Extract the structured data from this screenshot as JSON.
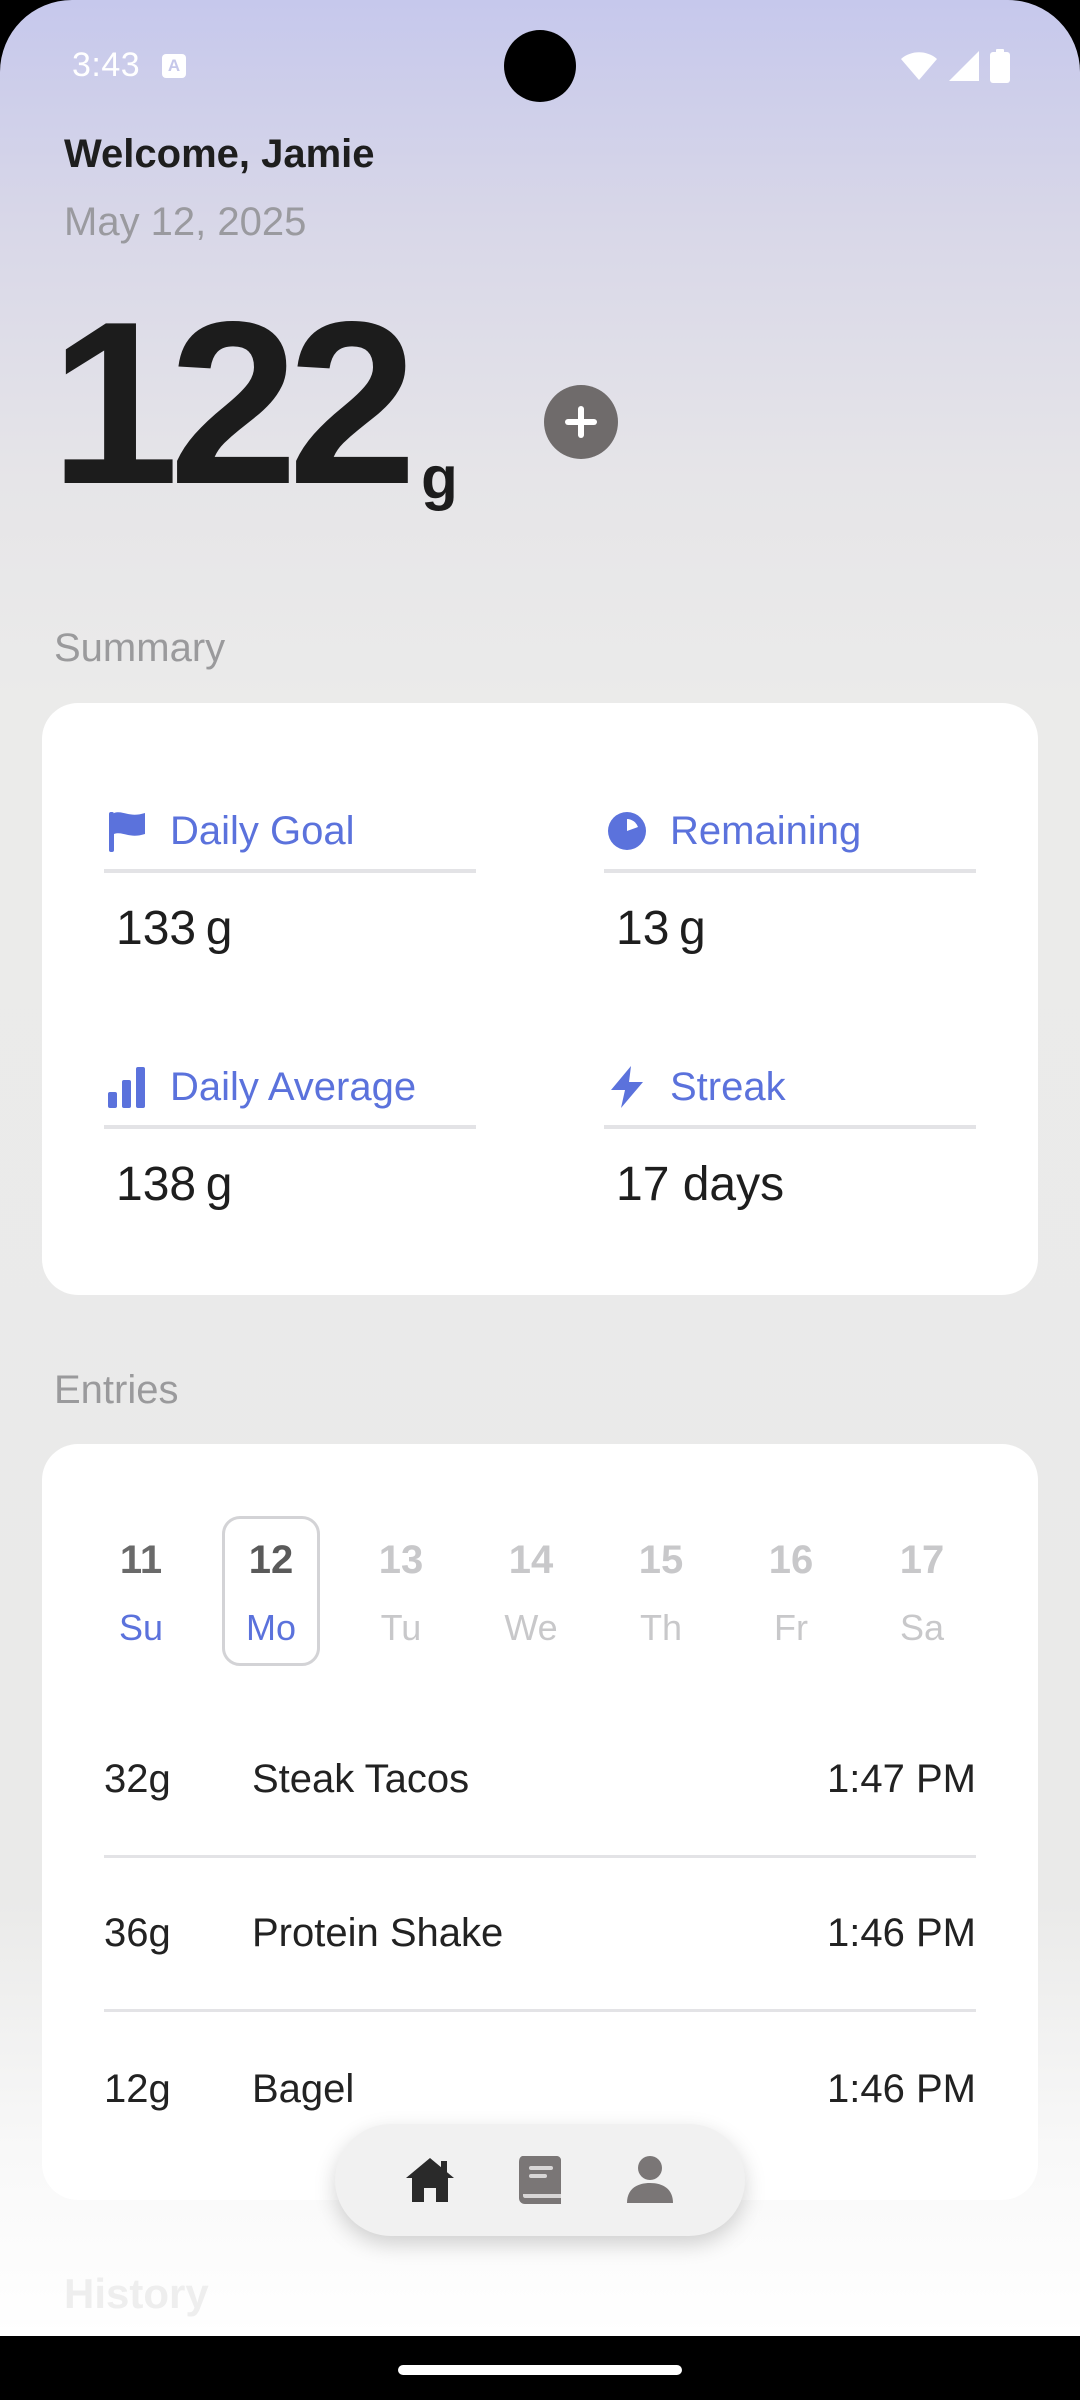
{
  "status_bar": {
    "time": "3:43",
    "badge": "A",
    "icons": [
      "wifi-icon",
      "signal-icon",
      "battery-icon"
    ]
  },
  "header": {
    "welcome": "Welcome, Jamie",
    "date": "May 12, 2025",
    "total_value": "122",
    "total_unit": "g",
    "add_icon": "plus-icon"
  },
  "summary": {
    "title": "Summary",
    "stats": [
      {
        "label": "Daily Goal",
        "value": "133 g",
        "icon": "flag-icon"
      },
      {
        "label": "Remaining",
        "value": "13 g",
        "icon": "pie-icon"
      },
      {
        "label": "Daily Average",
        "value": "138 g",
        "icon": "bar-chart-icon"
      },
      {
        "label": "Streak",
        "value": "17 days",
        "icon": "lightning-icon"
      }
    ]
  },
  "entries": {
    "title": "Entries",
    "days": [
      {
        "num": "11",
        "wd": "Su",
        "state": "past"
      },
      {
        "num": "12",
        "wd": "Mo",
        "state": "selected"
      },
      {
        "num": "13",
        "wd": "Tu",
        "state": "future"
      },
      {
        "num": "14",
        "wd": "We",
        "state": "future"
      },
      {
        "num": "15",
        "wd": "Th",
        "state": "future"
      },
      {
        "num": "16",
        "wd": "Fr",
        "state": "future"
      },
      {
        "num": "17",
        "wd": "Sa",
        "state": "future"
      }
    ],
    "items": [
      {
        "grams": "32g",
        "food": "Steak Tacos",
        "time": "1:47 PM"
      },
      {
        "grams": "36g",
        "food": "Protein Shake",
        "time": "1:46 PM"
      },
      {
        "grams": "12g",
        "food": "Bagel",
        "time": "1:46 PM"
      }
    ]
  },
  "history": {
    "title": "History"
  },
  "nav": {
    "items": [
      "home-icon",
      "book-icon",
      "person-icon"
    ]
  },
  "colors": {
    "accent": "#5b72dc",
    "text": "#1e1e1e",
    "muted": "#9a9a9c"
  }
}
